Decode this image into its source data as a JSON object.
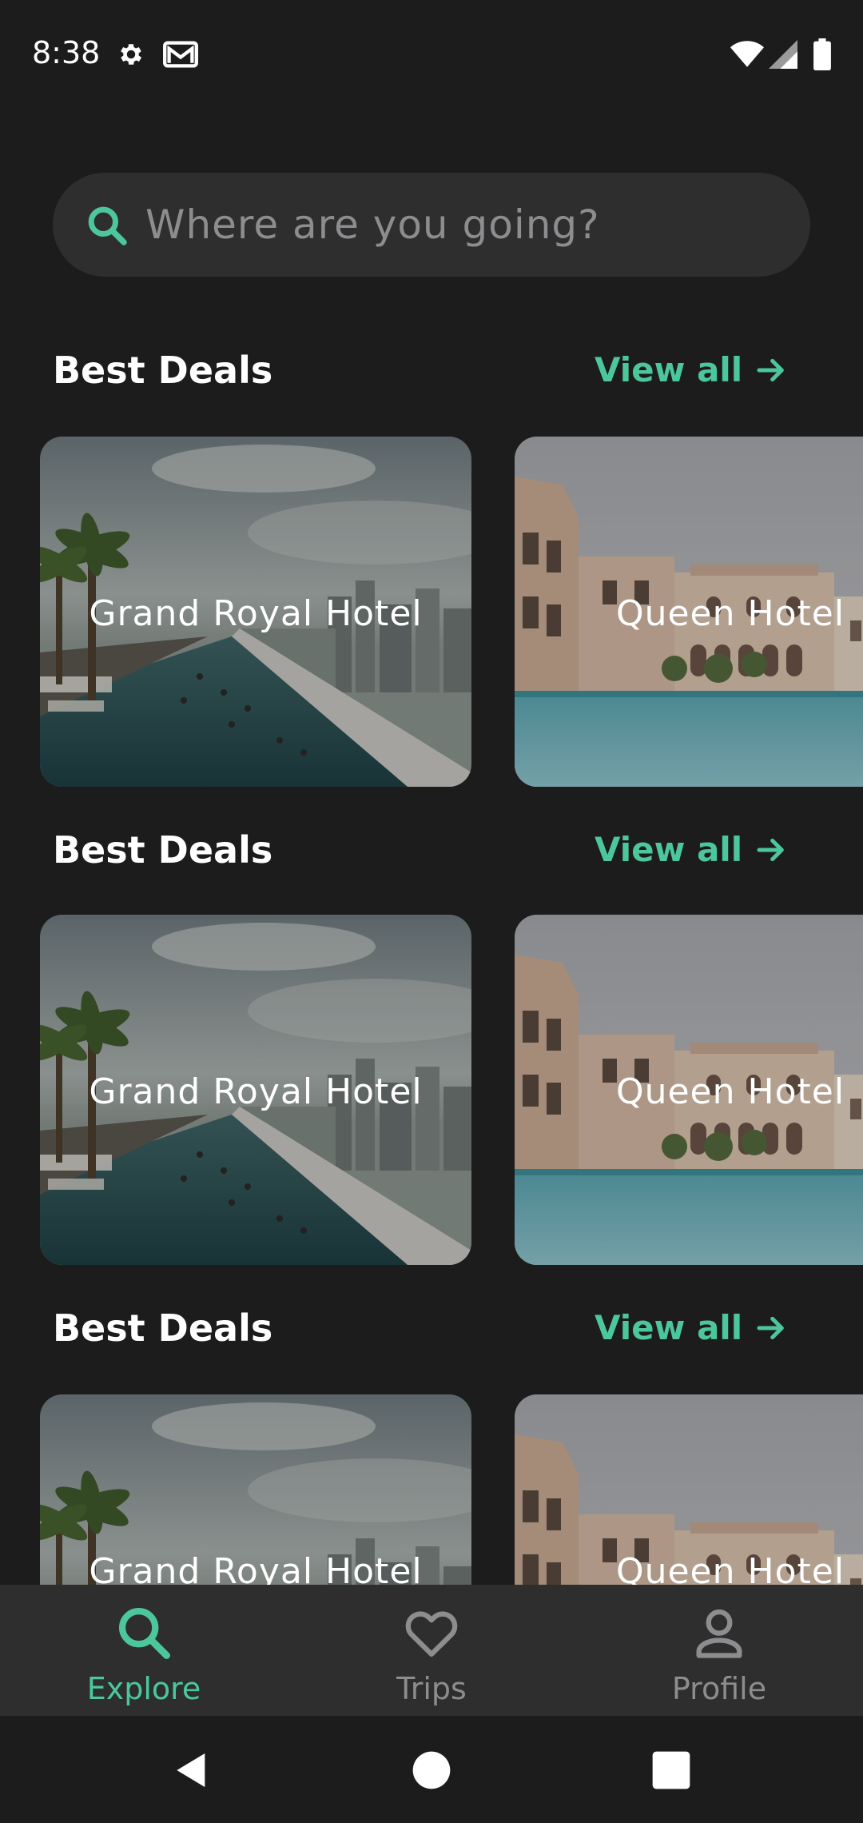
{
  "status_bar": {
    "time": "8:38",
    "icons": [
      "gear-icon",
      "gmail-icon",
      "wifi-icon",
      "signal-icon",
      "battery-icon"
    ]
  },
  "search": {
    "placeholder": "Where are you going?"
  },
  "sections": [
    {
      "title": "Best Deals",
      "view_all": "View all",
      "cards": [
        {
          "title": "Grand Royal Hotel",
          "image": "infinity-pool-photo"
        },
        {
          "title": "Queen Hotel",
          "image": "palace-pool-photo"
        }
      ]
    },
    {
      "title": "Best Deals",
      "view_all": "View all",
      "cards": [
        {
          "title": "Grand Royal Hotel",
          "image": "infinity-pool-photo"
        },
        {
          "title": "Queen Hotel",
          "image": "palace-pool-photo"
        }
      ]
    },
    {
      "title": "Best Deals",
      "view_all": "View all",
      "cards": [
        {
          "title": "Grand Royal Hotel",
          "image": "infinity-pool-photo"
        },
        {
          "title": "Queen Hotel",
          "image": "palace-pool-photo"
        }
      ]
    }
  ],
  "bottom_nav": {
    "items": [
      {
        "label": "Explore",
        "icon": "search-icon",
        "active": true
      },
      {
        "label": "Trips",
        "icon": "heart-icon",
        "active": false
      },
      {
        "label": "Profile",
        "icon": "person-icon",
        "active": false
      }
    ]
  },
  "colors": {
    "background": "#1c1c1d",
    "surface": "#2e2e2f",
    "accent": "#4cc79c",
    "inactive": "#8d8d8f",
    "text": "#ffffff"
  }
}
